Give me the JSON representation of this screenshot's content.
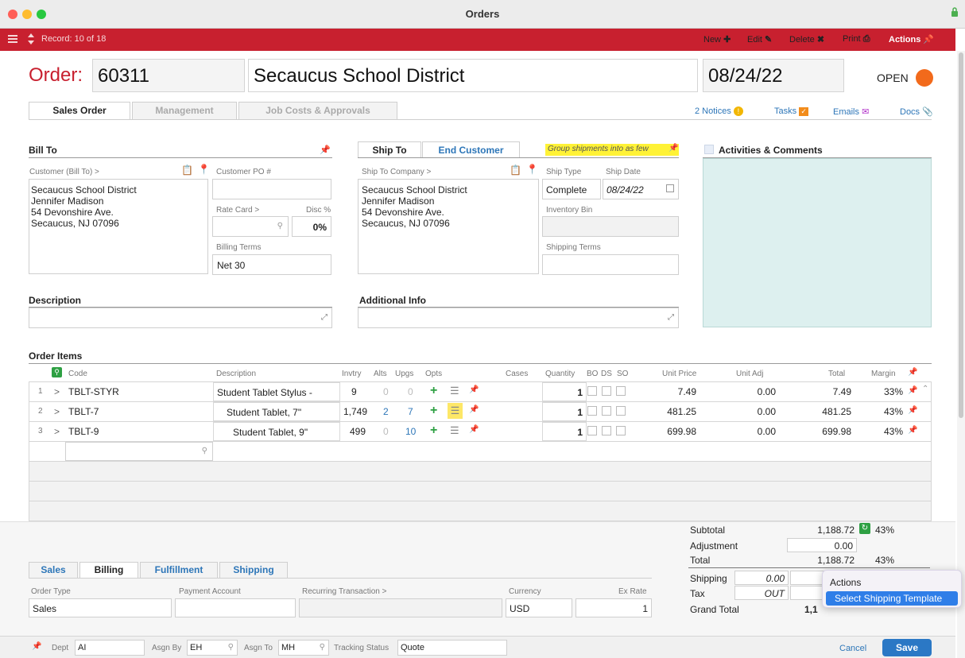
{
  "window": {
    "title": "Orders"
  },
  "toolbar": {
    "record": "Record: 10 of 18",
    "new": "New",
    "edit": "Edit",
    "delete": "Delete",
    "print": "Print",
    "actions": "Actions"
  },
  "header": {
    "order_label": "Order:",
    "order_number": "60311",
    "customer_name": "Secaucus School District",
    "date": "08/24/22",
    "status": "OPEN"
  },
  "tabs": [
    "Sales Order",
    "Management",
    "Job Costs & Approvals"
  ],
  "notices": {
    "notices": "2 Notices",
    "tasks": "Tasks",
    "emails": "Emails",
    "docs": "Docs"
  },
  "bill_to": {
    "title": "Bill To",
    "customer_label": "Customer (Bill To) >",
    "address": [
      "Secaucus School District",
      "Jennifer Madison",
      "54 Devonshire Ave.",
      "Secaucus, NJ 07096"
    ],
    "po_label": "Customer PO #",
    "po_value": "",
    "rate_card_label": "Rate Card >",
    "disc_label": "Disc %",
    "disc_value": "0%",
    "billing_terms_label": "Billing Terms",
    "billing_terms_value": "Net 30"
  },
  "ship_to": {
    "tab_ship": "Ship To",
    "tab_end": "End Customer",
    "group_note": "Group shipments into as few",
    "company_label": "Ship To Company >",
    "address": [
      "Secaucus School District",
      "Jennifer Madison",
      "54 Devonshire Ave.",
      "Secaucus, NJ 07096"
    ],
    "ship_type_label": "Ship Type",
    "ship_type_value": "Complete",
    "ship_date_label": "Ship Date",
    "ship_date_value": "08/24/22",
    "inventory_bin_label": "Inventory Bin",
    "shipping_terms_label": "Shipping Terms"
  },
  "activities": {
    "title": "Activities & Comments"
  },
  "description": {
    "title": "Description"
  },
  "additional": {
    "title": "Additional Info"
  },
  "order_items": {
    "title": "Order Items",
    "columns": {
      "code": "Code",
      "description": "Description",
      "invtry": "Invtry",
      "alts": "Alts",
      "upgs": "Upgs",
      "opts": "Opts",
      "cases": "Cases",
      "quantity": "Quantity",
      "bo": "BO",
      "ds": "DS",
      "so": "SO",
      "unit_price": "Unit Price",
      "unit_adj": "Unit Adj",
      "total": "Total",
      "margin": "Margin"
    },
    "rows": [
      {
        "n": "1",
        "code": "TBLT-STYR",
        "desc": "Student Tablet Stylus -",
        "invtry": "9",
        "alts": "0",
        "upgs": "0",
        "qty": "1",
        "price": "7.49",
        "adj": "0.00",
        "total": "7.49",
        "margin": "33%"
      },
      {
        "n": "2",
        "code": "TBLT-7",
        "desc": "Student Tablet, 7\"",
        "invtry": "1,749",
        "alts": "2",
        "upgs": "7",
        "qty": "1",
        "price": "481.25",
        "adj": "0.00",
        "total": "481.25",
        "margin": "43%"
      },
      {
        "n": "3",
        "code": "TBLT-9",
        "desc": "Student Tablet, 9\"",
        "invtry": "499",
        "alts": "0",
        "upgs": "10",
        "qty": "1",
        "price": "699.98",
        "adj": "0.00",
        "total": "699.98",
        "margin": "43%"
      }
    ],
    "arrow": ">"
  },
  "totals": {
    "subtotal_label": "Subtotal",
    "subtotal": "1,188.72",
    "subtotal_margin": "43%",
    "adjustment_label": "Adjustment",
    "adjustment": "0.00",
    "total_label": "Total",
    "total": "1,188.72",
    "total_margin": "43%",
    "shipping_label": "Shipping",
    "shipping": "0.00",
    "tax_label": "Tax",
    "tax": "OUT",
    "grand_label": "Grand Total",
    "grand": "1,1"
  },
  "context_menu": {
    "header": "Actions",
    "item": "Select Shipping Template"
  },
  "subtabs": [
    "Sales",
    "Billing",
    "Fulfillment",
    "Shipping"
  ],
  "billing": {
    "order_type_label": "Order Type",
    "order_type": "Sales",
    "payment_label": "Payment Account",
    "recurring_label": "Recurring Transaction >",
    "currency_label": "Currency",
    "currency": "USD",
    "ex_rate_label": "Ex Rate",
    "ex_rate": "1"
  },
  "bottom": {
    "dept_label": "Dept",
    "dept": "AI",
    "asgn_by_label": "Asgn By",
    "asgn_by": "EH",
    "asgn_to_label": "Asgn To",
    "asgn_to": "MH",
    "tracking_label": "Tracking Status",
    "tracking": "Quote",
    "cancel": "Cancel",
    "save": "Save"
  },
  "colors": {
    "brand": "#c8202f",
    "accent": "#2d76b8",
    "status": "#f26a1b",
    "activities_bg": "#ddf0ef"
  }
}
